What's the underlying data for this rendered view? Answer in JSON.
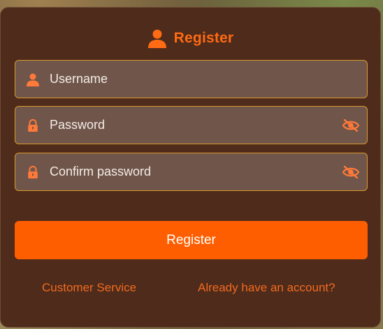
{
  "form": {
    "title": "Register",
    "username": {
      "placeholder": "Username",
      "value": ""
    },
    "password": {
      "placeholder": "Password",
      "value": ""
    },
    "confirm_password": {
      "placeholder": "Confirm password",
      "value": ""
    },
    "submit_label": "Register"
  },
  "links": {
    "customer_service": "Customer Service",
    "login": "Already have an account?"
  },
  "icons": {
    "title": "user-icon",
    "username": "user-icon",
    "password": "lock-icon",
    "confirm": "lock-icon",
    "toggle": "eye-slash-icon"
  },
  "colors": {
    "panel": "#4e2b1b",
    "accent": "#ff5e00",
    "field_bg": "#70554a",
    "field_border": "#d89a2e"
  }
}
